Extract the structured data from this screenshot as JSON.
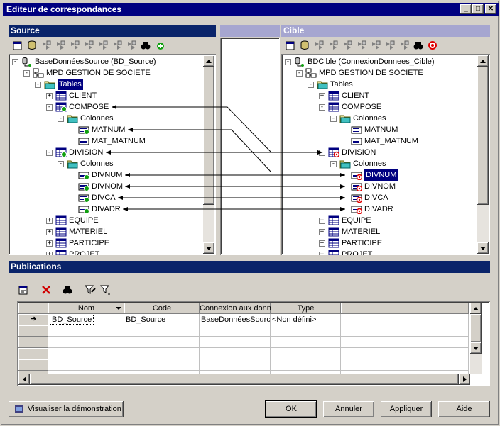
{
  "window": {
    "title": "Editeur de correspondances"
  },
  "colors": {
    "title_bg": "#000080",
    "source_header": "#0a246a",
    "cible_header": "#a6a6d0",
    "link_line": "#000000"
  },
  "source": {
    "header": "Source",
    "nodes": [
      {
        "label": "BaseDonnéesSource (BD_Source)",
        "icon": "database-connection-icon"
      },
      {
        "label": "MPD GESTION DE SOCIETE",
        "icon": "model-icon"
      },
      {
        "label": "Tables",
        "icon": "folder-icon"
      },
      {
        "label": "CLIENT",
        "icon": "table-icon"
      },
      {
        "label": "COMPOSE",
        "icon": "table-mapped-icon"
      },
      {
        "label": "Colonnes",
        "icon": "folder-icon"
      },
      {
        "label": "MATNUM",
        "icon": "column-mapped-icon"
      },
      {
        "label": "MAT_MATNUM",
        "icon": "column-icon"
      },
      {
        "label": "DIVISION",
        "icon": "table-mapped-icon"
      },
      {
        "label": "Colonnes",
        "icon": "folder-icon"
      },
      {
        "label": "DIVNUM",
        "icon": "column-mapped-icon"
      },
      {
        "label": "DIVNOM",
        "icon": "column-mapped-icon"
      },
      {
        "label": "DIVCA",
        "icon": "column-mapped-icon"
      },
      {
        "label": "DIVADR",
        "icon": "column-mapped-icon"
      },
      {
        "label": "EQUIPE",
        "icon": "table-icon"
      },
      {
        "label": "MATERIEL",
        "icon": "table-icon"
      },
      {
        "label": "PARTICIPE",
        "icon": "table-icon"
      },
      {
        "label": "PROJET",
        "icon": "table-icon"
      }
    ]
  },
  "cible": {
    "header": "Cible",
    "nodes": [
      {
        "label": "BDCible (ConnexionDonnees_Cible)",
        "icon": "database-connection-icon"
      },
      {
        "label": "MPD GESTION DE SOCIETE",
        "icon": "model-icon"
      },
      {
        "label": "Tables",
        "icon": "folder-icon"
      },
      {
        "label": "CLIENT",
        "icon": "table-icon"
      },
      {
        "label": "COMPOSE",
        "icon": "table-icon"
      },
      {
        "label": "Colonnes",
        "icon": "folder-icon"
      },
      {
        "label": "MATNUM",
        "icon": "column-icon"
      },
      {
        "label": "MAT_MATNUM",
        "icon": "column-icon"
      },
      {
        "label": "DIVISION",
        "icon": "table-target-icon"
      },
      {
        "label": "Colonnes",
        "icon": "folder-icon"
      },
      {
        "label": "DIVNUM",
        "icon": "column-target-icon"
      },
      {
        "label": "DIVNOM",
        "icon": "column-target-icon"
      },
      {
        "label": "DIVCA",
        "icon": "column-target-icon"
      },
      {
        "label": "DIVADR",
        "icon": "column-target-icon"
      },
      {
        "label": "EQUIPE",
        "icon": "table-icon"
      },
      {
        "label": "MATERIEL",
        "icon": "table-icon"
      },
      {
        "label": "PARTICIPE",
        "icon": "table-icon"
      },
      {
        "label": "PROJET",
        "icon": "table-icon"
      }
    ]
  },
  "publications": {
    "header": "Publications",
    "columns": [
      "Nom",
      "Code",
      "Connexion aux donn",
      "Type"
    ],
    "rows": [
      [
        "BD_Source",
        "BD_Source",
        "BaseDonnéesSourc",
        "<Non défini>"
      ]
    ],
    "row_indicator": "➔"
  },
  "buttons": {
    "demo": "Visualiser la démonstration",
    "ok": "OK",
    "cancel": "Annuler",
    "apply": "Appliquer",
    "help": "Aide"
  }
}
